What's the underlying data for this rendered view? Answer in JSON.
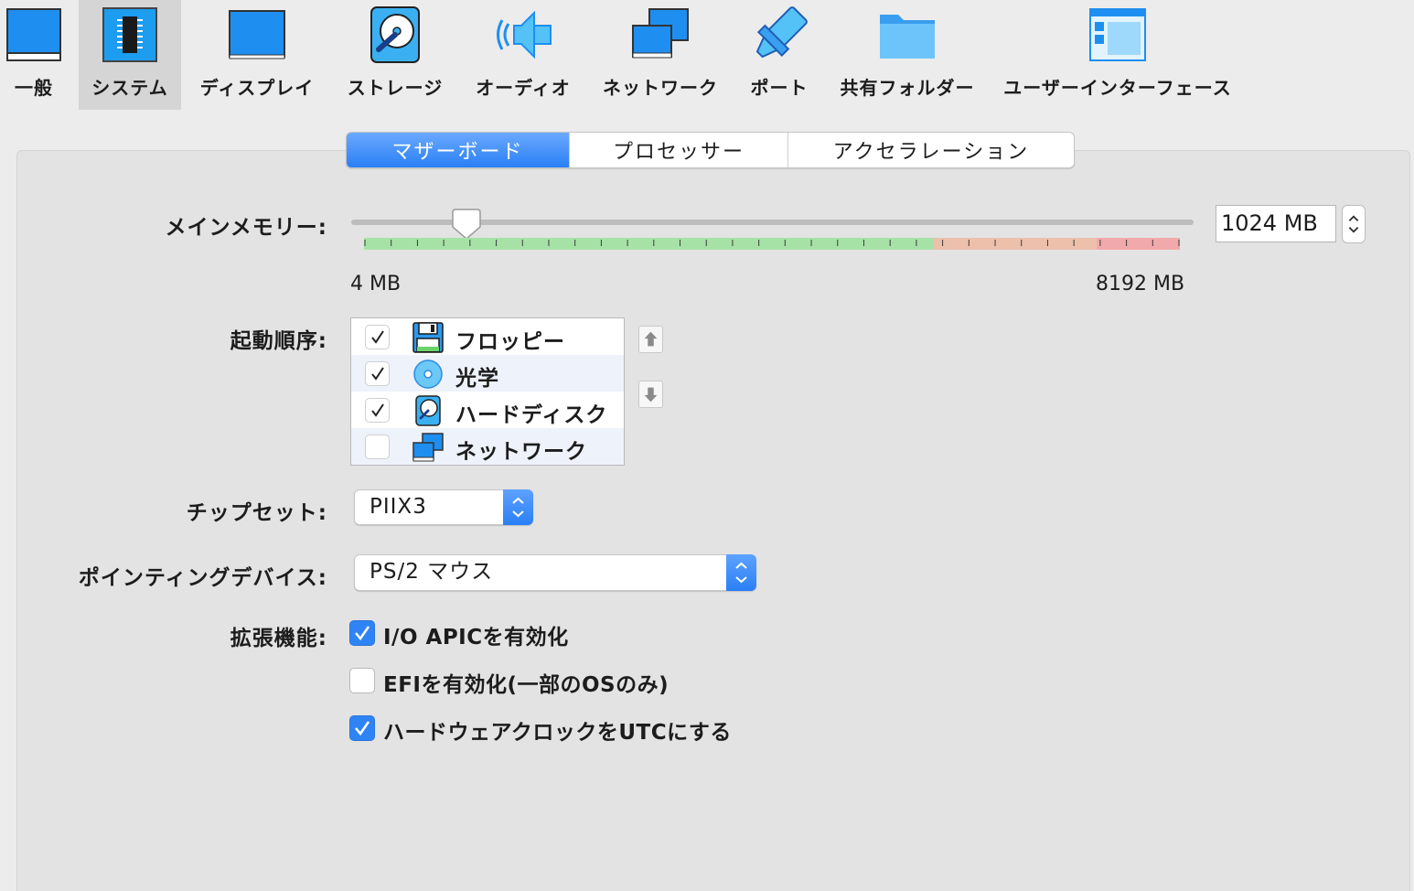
{
  "toolbar": {
    "items": [
      {
        "label": "一般",
        "icon": "monitor-icon"
      },
      {
        "label": "システム",
        "icon": "chip-icon"
      },
      {
        "label": "ディスプレイ",
        "icon": "display-icon"
      },
      {
        "label": "ストレージ",
        "icon": "hard-disk-icon"
      },
      {
        "label": "オーディオ",
        "icon": "speaker-icon"
      },
      {
        "label": "ネットワーク",
        "icon": "network-icon"
      },
      {
        "label": "ポート",
        "icon": "port-connector-icon"
      },
      {
        "label": "共有フォルダー",
        "icon": "folder-icon"
      },
      {
        "label": "ユーザーインターフェース",
        "icon": "window-layout-icon"
      }
    ],
    "selected": "システム"
  },
  "tabs": {
    "items": [
      "マザーボード",
      "プロセッサー",
      "アクセラレーション"
    ],
    "active": "マザーボード"
  },
  "memory": {
    "label": "メインメモリー:",
    "value": "1024 MB",
    "min_label": "4 MB",
    "max_label": "8192 MB",
    "value_mb": 1024,
    "max_mb": 8192
  },
  "boot_order": {
    "label": "起動順序:",
    "items": [
      {
        "label": "フロッピー",
        "checked": true,
        "icon": "floppy-icon"
      },
      {
        "label": "光学",
        "checked": true,
        "icon": "optical-disc-icon"
      },
      {
        "label": "ハードディスク",
        "checked": true,
        "icon": "hard-disk-icon"
      },
      {
        "label": "ネットワーク",
        "checked": false,
        "icon": "network-icon"
      }
    ]
  },
  "chipset": {
    "label": "チップセット:",
    "value": "PIIX3"
  },
  "pointing": {
    "label": "ポインティングデバイス:",
    "value": "PS/2 マウス"
  },
  "extended": {
    "label": "拡張機能:",
    "options": [
      {
        "label": "I/O APICを有効化",
        "checked": true
      },
      {
        "label": "EFIを有効化(一部のOSのみ)",
        "checked": false
      },
      {
        "label": "ハードウェアクロックをUTCにする",
        "checked": true
      }
    ]
  },
  "colors": {
    "accent": "#2f84f5",
    "scale_green": "#a6e2a6",
    "scale_orange": "#edc0ac",
    "scale_red": "#f2a9ac"
  }
}
